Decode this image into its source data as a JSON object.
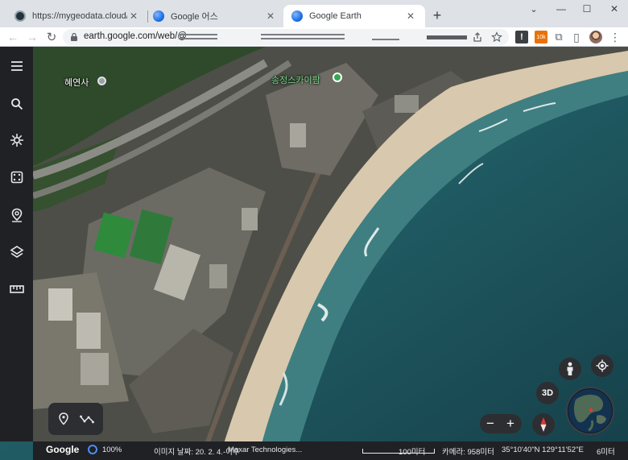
{
  "browser": {
    "tabs": [
      {
        "title": "https://mygeodata.cloud/result",
        "active": false
      },
      {
        "title": "Google 어스",
        "active": false
      },
      {
        "title": "Google Earth",
        "active": true
      }
    ],
    "new_tab_label": "+",
    "window_controls": {
      "minimize": "—",
      "maximize": "☐",
      "close": "✕"
    },
    "url": "earth.google.com/web/@",
    "colors": {
      "tab_strip": "#dee1e6",
      "active_tab": "#ffffff",
      "omnibox": "#f1f3f4"
    }
  },
  "extensions": [
    {
      "name": "extension-dark-icon",
      "label": "!"
    },
    {
      "name": "extension-orange-icon",
      "label": "10k"
    },
    {
      "name": "puzzle-icon",
      "label": "⧉"
    },
    {
      "name": "side-panel-icon",
      "label": "▯"
    },
    {
      "name": "profile-avatar",
      "label": ""
    },
    {
      "name": "more-menu-icon",
      "label": "⋮"
    }
  ],
  "earth": {
    "map_labels": [
      {
        "name": "poi-temple",
        "text": "혜연사"
      },
      {
        "name": "poi-skypark",
        "text": "송정스카이팜"
      }
    ],
    "left_toolbar": [
      {
        "name": "menu-icon"
      },
      {
        "name": "search-icon"
      },
      {
        "name": "voyager-icon"
      },
      {
        "name": "feeling-lucky-dice-icon"
      },
      {
        "name": "projects-pin-icon"
      },
      {
        "name": "map-style-layers-icon"
      },
      {
        "name": "measure-ruler-icon"
      }
    ],
    "view_mode": "3D",
    "zoom_out": "−",
    "zoom_in": "+",
    "status": {
      "logo": "Google",
      "zoom_percent": "100%",
      "imagery_date": "이미지 날짜: 20. 2. 4.-이후",
      "attribution": "Maxar Technologies...",
      "scale": "100미터",
      "camera": "카메라: 958미터",
      "coordinates": "35°10'40\"N 129°11'52\"E",
      "altitude": "6미터"
    },
    "colors": {
      "sidebar": "#202124",
      "sea_deep": "#1f4d55",
      "sea_shallow": "#3f7f82",
      "beach": "#d8c8ad",
      "land": "#5a5a52",
      "park_green": "#2f7a3a",
      "poi_green": "#34a853",
      "compass_red": "#e53935"
    }
  }
}
